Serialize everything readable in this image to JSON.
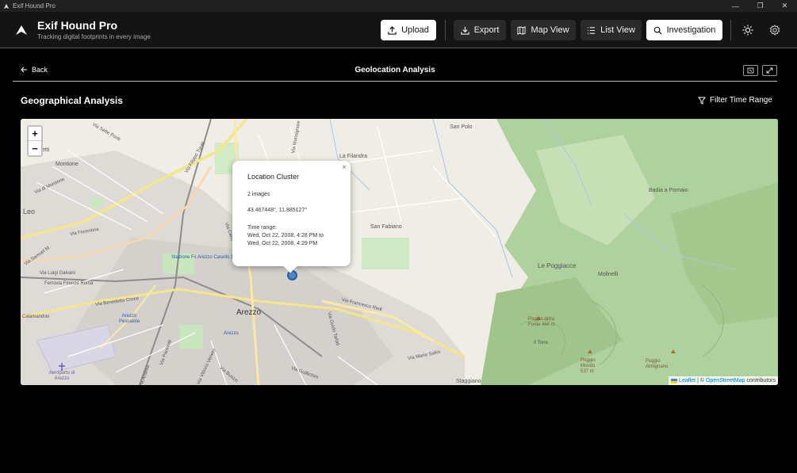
{
  "window": {
    "title": "Exif Hound Pro"
  },
  "header": {
    "brand_title": "Exif Hound Pro",
    "brand_subtitle": "Tracking digital footprints in every image",
    "buttons": {
      "upload": "Upload",
      "export": "Export",
      "map_view": "Map View",
      "list_view": "List View",
      "investigation": "Investigation"
    }
  },
  "subbar": {
    "back": "Back",
    "title": "Geolocation Analysis"
  },
  "section": {
    "title": "Geographical Analysis",
    "filter": "Filter Time Range"
  },
  "map": {
    "zoom_in": "+",
    "zoom_out": "−",
    "labels": {
      "san_polo": "San Polo",
      "la_filandra": "La Filandra",
      "badia": "Badia a Pomaio",
      "san_fabiano": "San Fabiano",
      "le_poggiacce": "Le Poggiacce",
      "molinelli": "Molinelli",
      "arezzo": "Arezzo",
      "montione": "Montione",
      "stazione": "Stazione Fs Arezzo Casello 1",
      "arezzo_pescaiola": "Arezzo Pescaiola",
      "aeroporto": "Aeroporto di Arezzo",
      "poggio_fonte": "Poggio della Fonte 464 m",
      "il_torre": "Il Torre",
      "poggio_mondo": "Poggio Mondo 537 m",
      "poggio_almignano": "Poggio Almignano",
      "via_francesco_redi": "Via Francesco Redi",
      "via_mario_salini": "Via Mario Salini",
      "via_benedetto_croce": "Via Benedetto Croce",
      "staggiano": "Staggiano",
      "via_sette_ponti": "Via Sette Ponti",
      "via_filippo_turati": "Via Filippo Turati",
      "via_fiorentina": "Via Fiorentina",
      "via_di_montione": "Via di Montione",
      "via_luigi_galvani": "Via Luigi Galvani",
      "ferrovia": "Ferrovia Firenze Roma",
      "via_samuel": "Via Samuel M.",
      "via_monsignore": "Via Monsignore",
      "via_carlo_dolfi": "Via Carlo Dolfi",
      "leo": "Leo",
      "etti": "etti",
      "calamandrei": "Calamandrei",
      "arezzo_small": "Arezzo",
      "via_vittorio_veneto": "Via Vittorio Veneto",
      "via_guido_tarlati": "Via Guido Tarlati",
      "via_andrea": "Via Andrea",
      "via_pacinotti": "Via Pacinotti",
      "via_buozzi": "Via Buozzi",
      "via_guillichini": "Via Guillichini"
    },
    "popup": {
      "close": "×",
      "title": "Location Cluster",
      "count": "2 images",
      "coords": "43.467448°, 11.885127°",
      "time_label": "Time range:",
      "time_from": "Wed, Oct 22, 2008, 4:28 PM to",
      "time_to": "Wed, Oct 22, 2008, 4:29 PM"
    },
    "attribution": {
      "leaflet": "Leaflet",
      "sep": "| ©",
      "osm": "OpenStreetMap",
      "contributors": "contributors"
    }
  }
}
